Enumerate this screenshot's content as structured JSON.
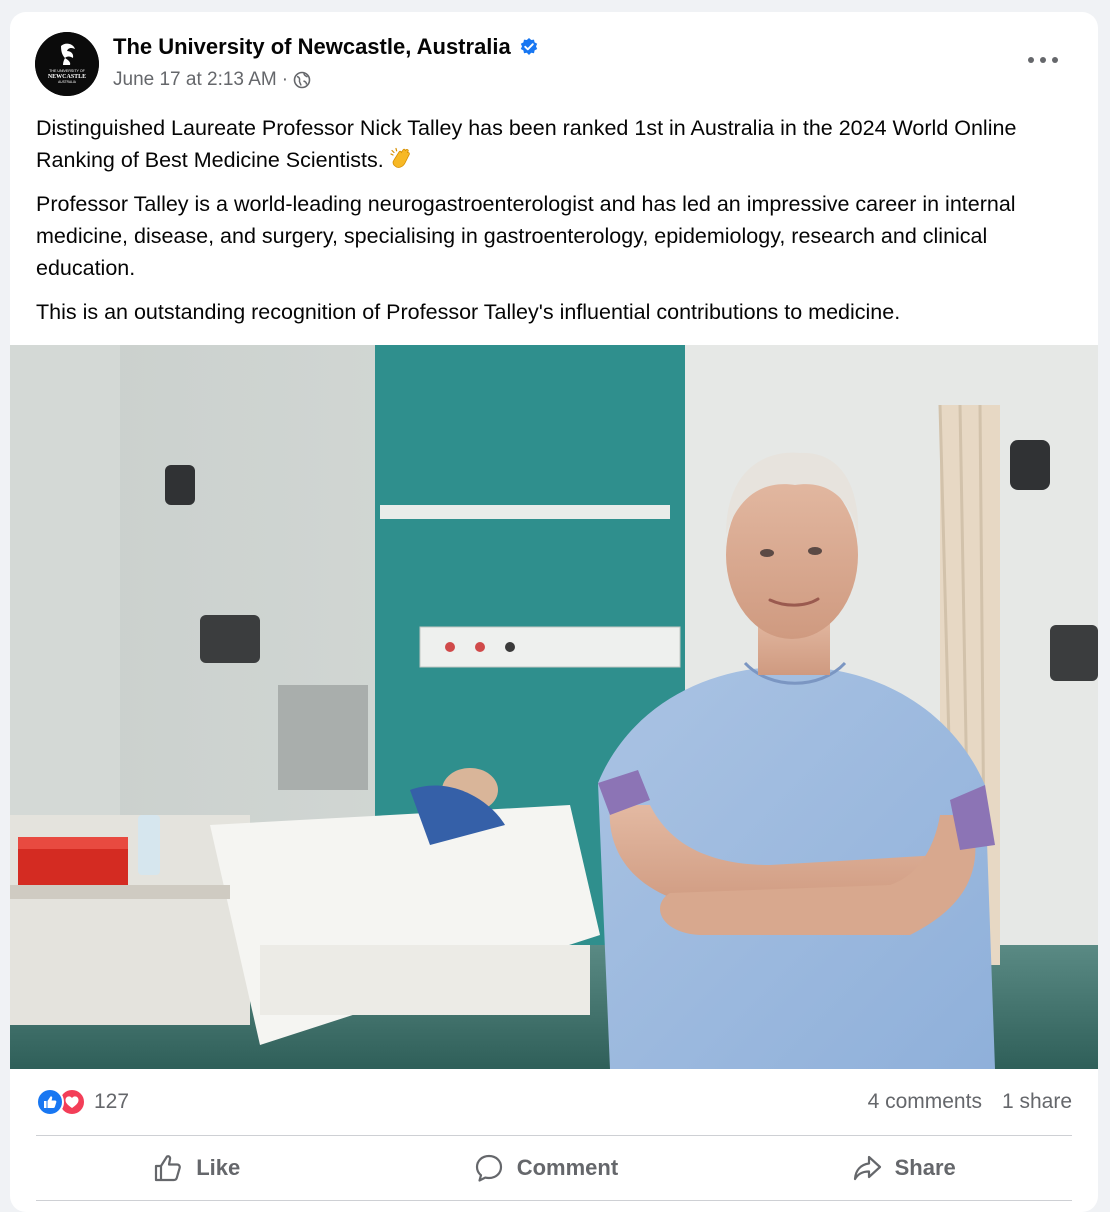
{
  "post": {
    "page_name": "The University of Newcastle, Australia",
    "verified_icon": "verified-badge-icon",
    "timestamp": "June 17 at 2:13 AM",
    "separator": "·",
    "audience_icon": "globe-icon",
    "avatar_text": {
      "line1": "THE UNIVERSITY OF",
      "line2": "NEWCASTLE",
      "line3": "AUSTRALIA"
    },
    "paragraphs": [
      "Distinguished Laureate Professor Nick Talley has been ranked 1st in Australia in the 2024 World Online Ranking of Best Medicine Scientists.",
      "Professor Talley is a world-leading neurogastroenterologist and has led an impressive career in internal medicine, disease, and surgery, specialising in gastroenterology, epidemiology, research and clinical education.",
      "This is an outstanding recognition of Professor Talley's influential contributions to medicine."
    ],
    "emoji": "clapping-hands-emoji"
  },
  "stats": {
    "reaction_count": "127",
    "comments": "4 comments",
    "shares": "1 share"
  },
  "actions": {
    "like": "Like",
    "comment": "Comment",
    "share": "Share"
  },
  "colors": {
    "brand_blue": "#1877f2",
    "love_red": "#f33e58",
    "secondary_text": "#65676b"
  }
}
